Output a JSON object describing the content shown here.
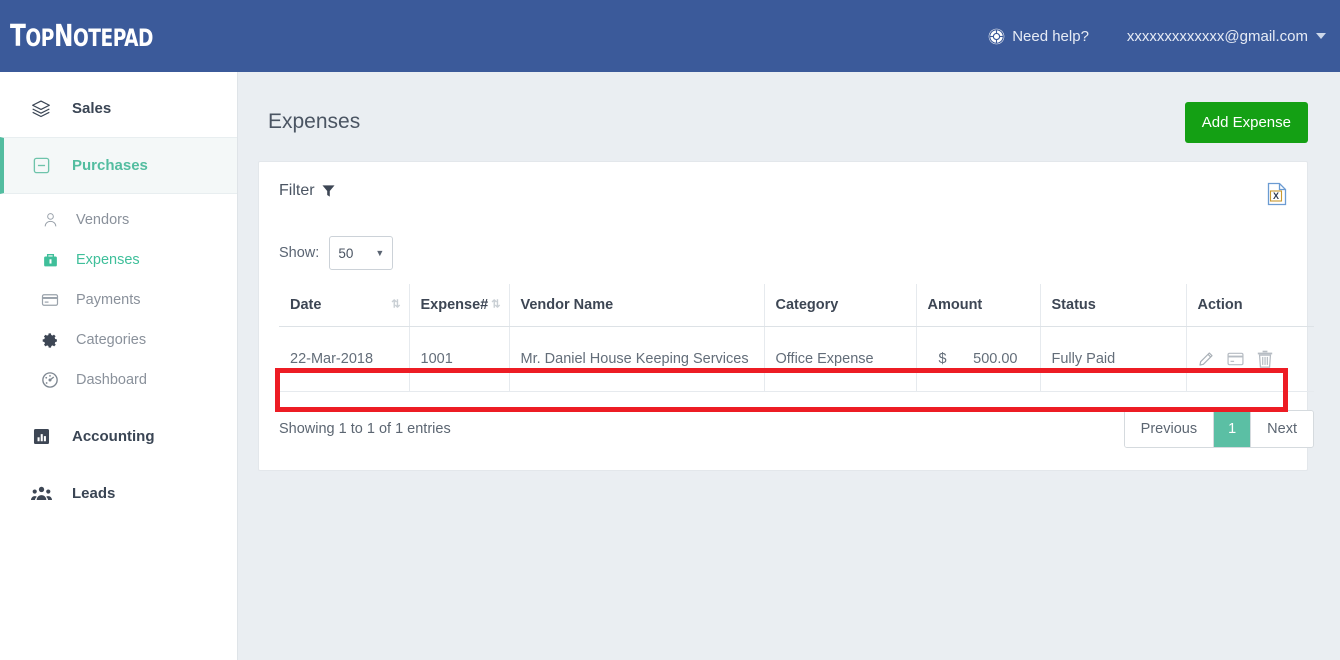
{
  "brand": {
    "part1": "T",
    "part2": "OP",
    "part3": "N",
    "part4": "OTEPAD",
    "full": "TopNotepad"
  },
  "header": {
    "help_label": "Need help?",
    "help_icon": "lifering-icon",
    "user_email": "xxxxxxxxxxxxx@gmail.com",
    "caret_icon": "caret-down-icon",
    "bg_color": "#3b5a9a"
  },
  "sidebar": {
    "items": [
      {
        "label": "Sales",
        "icon": "layers-icon",
        "level": "top",
        "active": false
      },
      {
        "label": "Purchases",
        "icon": "minus-square-icon",
        "level": "top",
        "active": true
      },
      {
        "label": "Vendors",
        "icon": "user-tie-icon",
        "level": "sub",
        "active": false
      },
      {
        "label": "Expenses",
        "icon": "briefcase-icon",
        "level": "sub",
        "active": true
      },
      {
        "label": "Payments",
        "icon": "credit-card-icon",
        "level": "sub",
        "active": false
      },
      {
        "label": "Categories",
        "icon": "gear-icon",
        "level": "sub",
        "active": false
      },
      {
        "label": "Dashboard",
        "icon": "tachometer-icon",
        "level": "sub",
        "active": false
      },
      {
        "label": "Accounting",
        "icon": "bar-chart-icon",
        "level": "top",
        "active": false
      },
      {
        "label": "Leads",
        "icon": "users-icon",
        "level": "top",
        "active": false
      }
    ],
    "active_color": "#53bda0",
    "sub_active_color": "#3fbf9a"
  },
  "main": {
    "page_title": "Expenses",
    "add_button": "Add Expense",
    "add_button_color": "#14a014",
    "filter_label": "Filter",
    "filter_icon": "funnel-icon",
    "export_icon": "excel-file-icon"
  },
  "table_controls": {
    "show_label": "Show:",
    "show_value": "50",
    "show_options": [
      "50"
    ],
    "dropdown_icon": "caret-down-icon"
  },
  "table": {
    "columns": [
      {
        "label": "Date",
        "sortable": true
      },
      {
        "label": "Expense#",
        "sortable": true
      },
      {
        "label": "Vendor Name",
        "sortable": false
      },
      {
        "label": "Category",
        "sortable": false
      },
      {
        "label": "Amount",
        "sortable": false
      },
      {
        "label": "Status",
        "sortable": false
      },
      {
        "label": "Action",
        "sortable": false
      }
    ],
    "sort_icon": "sort-updown-icon",
    "rows": [
      {
        "date": "22-Mar-2018",
        "expense_no": "1001",
        "vendor_name": "Mr. Daniel House Keeping Services",
        "category": "Office Expense",
        "currency": "$",
        "amount": "500.00",
        "status": "Fully Paid",
        "actions": [
          "edit-pencil-icon",
          "payment-card-icon",
          "delete-trash-icon"
        ]
      }
    ],
    "highlight_color": "#ed1c24"
  },
  "footer": {
    "entries_text": "Showing 1 to 1 of 1 entries",
    "previous_label": "Previous",
    "current_page": "1",
    "next_label": "Next",
    "active_page_color": "#5bbfa4"
  }
}
